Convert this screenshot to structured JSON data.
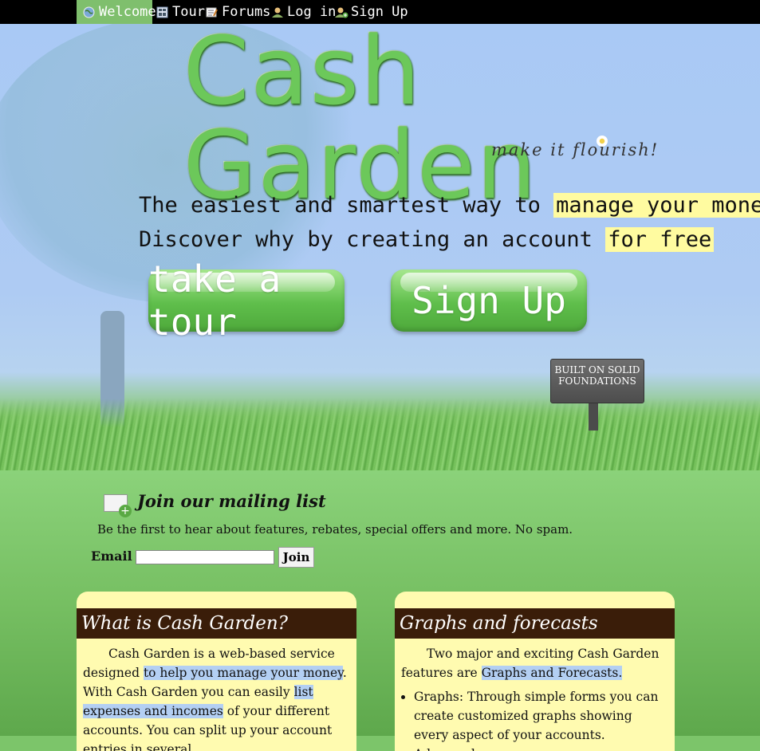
{
  "nav": {
    "items": [
      {
        "label": "Welcome",
        "icon": "globe-icon",
        "active": true
      },
      {
        "label": "Tour",
        "icon": "calculator-icon",
        "active": false
      },
      {
        "label": "Forums",
        "icon": "notepad-icon",
        "active": false
      },
      {
        "label": "Log in",
        "icon": "user-icon",
        "active": false
      },
      {
        "label": "Sign Up",
        "icon": "user-add-icon",
        "active": false
      }
    ]
  },
  "hero": {
    "logo": "Cash Garden",
    "tagline": "make it flourish!",
    "line1_prefix": "The easiest and smartest way to ",
    "line1_highlight": "manage your money",
    "line2_prefix": "Discover why by creating an account ",
    "line2_highlight": "for free",
    "tour_button": "take a tour",
    "signup_button": "Sign Up",
    "sign_text": "BUILT ON SOLID FOUNDATIONS"
  },
  "mailing": {
    "title": "Join our mailing list",
    "description": "Be the first to hear about features, rebates, special offers and more. No spam.",
    "email_label": "Email",
    "email_value": "",
    "join_label": "Join"
  },
  "cards": {
    "what": {
      "title": "What is Cash Garden?",
      "t1": "Cash Garden is a web-based service designed ",
      "h1": "to help you manage your money",
      "t2": ". With Cash Garden you can easily ",
      "h2": "list expenses and incomes",
      "t3": " of your different accounts. You can split up your account entries in several"
    },
    "graphs": {
      "title": "Graphs and forecasts",
      "t1": "Two major and exciting Cash Garden features are ",
      "h1": "Graphs and Forecasts.",
      "bullet1": "Graphs: Through simple forms you can create customized graphs showing every aspect of your accounts. Advanced users"
    }
  },
  "colors": {
    "nav_bg": "#000000",
    "nav_active": "#7fbf6d",
    "highlight_yellow": "#fffba0",
    "card_bg": "#fffbb0",
    "card_head": "#3a1d09",
    "highlight_blue": "#b3cff3"
  }
}
